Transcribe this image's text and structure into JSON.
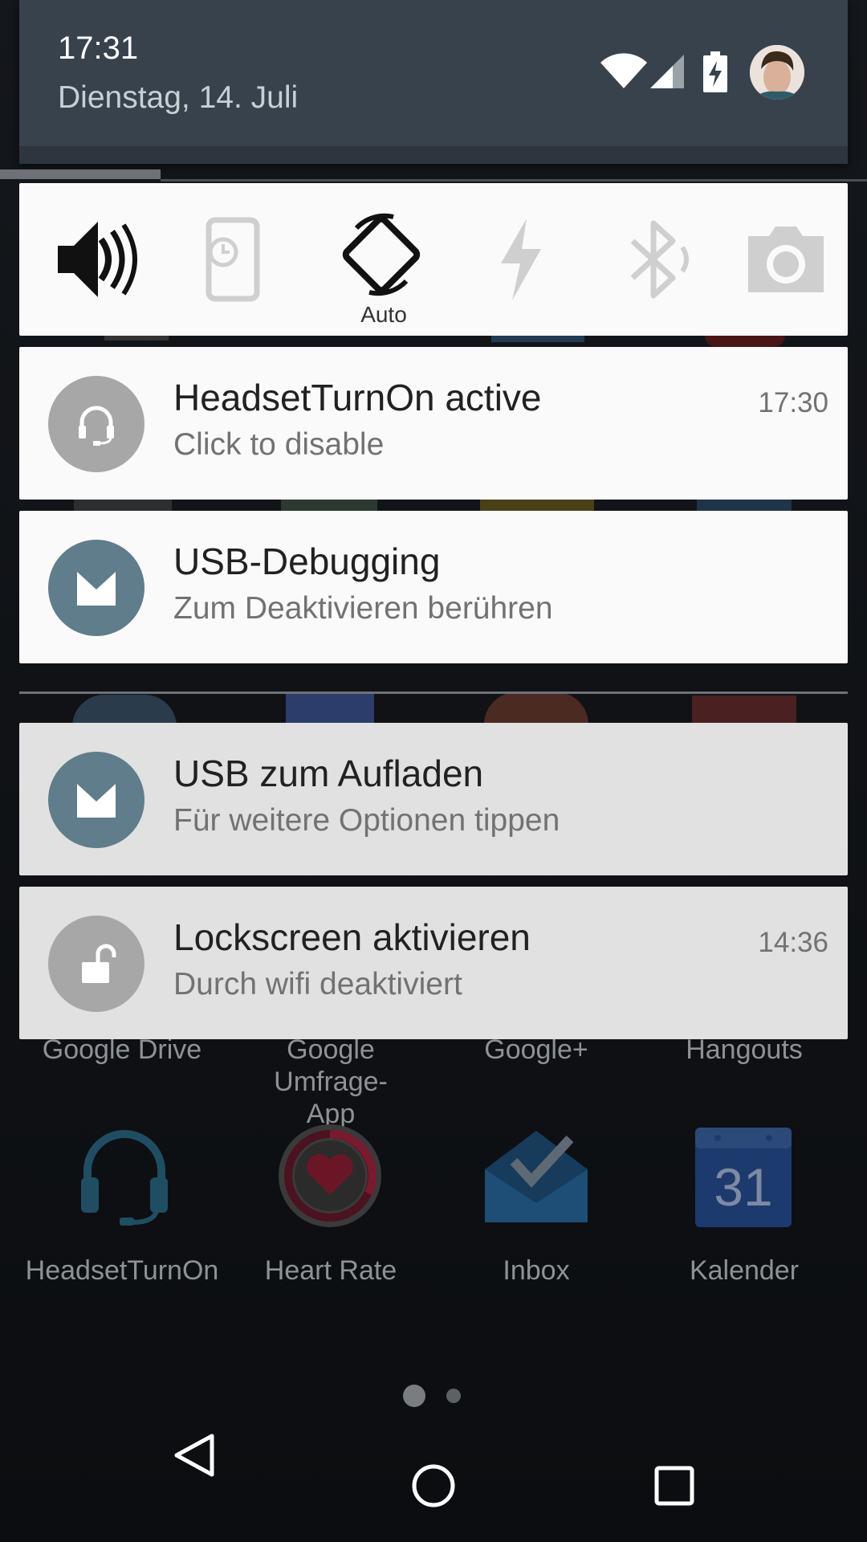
{
  "header": {
    "time": "17:31",
    "date": "Dienstag, 14. Juli",
    "icons": [
      "wifi-icon",
      "cell-signal-icon",
      "battery-charging-icon",
      "user-avatar"
    ]
  },
  "quick_settings": {
    "tiles": [
      "volume-icon",
      "vibrate-timer-icon",
      "auto-rotate-icon",
      "flashlight-icon",
      "bluetooth-icon",
      "camera-icon"
    ],
    "rotate_label": "Auto"
  },
  "notifications": [
    {
      "title": "HeadsetTurnOn active",
      "text": "Click to disable",
      "time": "17:30",
      "icon": "headset-icon",
      "icon_color": "#a7a7a7"
    },
    {
      "title": "USB-Debugging",
      "text": "Zum Deaktivieren berühren",
      "time": "",
      "icon": "android-m-icon",
      "icon_color": "#607d8b"
    },
    {
      "title": "USB zum Aufladen",
      "text": "Für weitere Optionen tippen",
      "time": "",
      "icon": "android-m-icon",
      "icon_color": "#607d8b"
    },
    {
      "title": "Lockscreen aktivieren",
      "text": "Durch wifi deaktiviert",
      "time": "14:36",
      "icon": "unlock-icon",
      "icon_color": "#a7a7a7"
    }
  ],
  "launcher": {
    "row1_labels": [
      "Google Drive",
      "Google Umfrage-\nApp",
      "Google+",
      "Hangouts"
    ],
    "row2_labels": [
      "HeadsetTurnOn",
      "Heart Rate",
      "Inbox",
      "Kalender"
    ],
    "calendar_day": "31",
    "pages": 2,
    "current_page": 1
  },
  "navbar": {
    "buttons": [
      "back-button",
      "home-button",
      "recents-button"
    ]
  }
}
